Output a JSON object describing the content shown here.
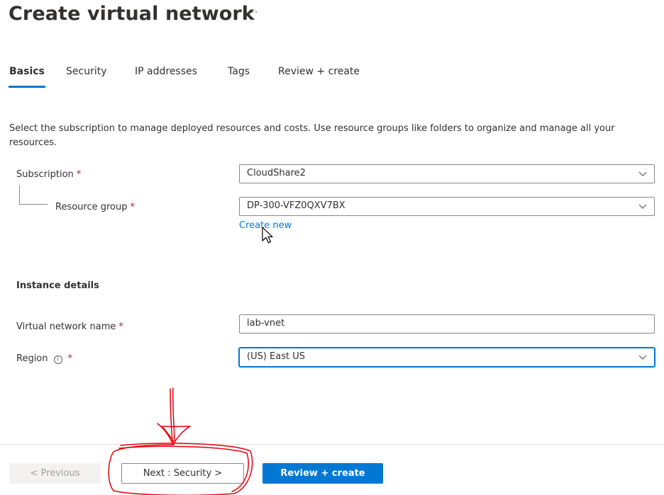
{
  "page": {
    "title": "Create virtual network",
    "more_label": "···"
  },
  "tabs": [
    {
      "label": "Basics",
      "active": true
    },
    {
      "label": "Security",
      "active": false
    },
    {
      "label": "IP addresses",
      "active": false
    },
    {
      "label": "Tags",
      "active": false
    },
    {
      "label": "Review + create",
      "active": false
    }
  ],
  "description": "Select the subscription to manage deployed resources and costs. Use resource groups like folders to organize and manage all your resources.",
  "form": {
    "subscription": {
      "label": "Subscription",
      "required": "*",
      "value": "CloudShare2"
    },
    "resource_group": {
      "label": "Resource group",
      "required": "*",
      "value": "DP-300-VFZ0QXV7BX",
      "create_new": "Create new"
    },
    "instance_heading": "Instance details",
    "vnet_name": {
      "label": "Virtual network name",
      "required": "*",
      "value": "lab-vnet"
    },
    "region": {
      "label": "Region",
      "info": "i",
      "required": "*",
      "value": "(US) East US"
    }
  },
  "footer": {
    "previous": "< Previous",
    "next": "Next : Security >",
    "review": "Review + create"
  },
  "colors": {
    "accent": "#0078d4",
    "required": "#a4262c",
    "annotation": "#e8000b"
  }
}
